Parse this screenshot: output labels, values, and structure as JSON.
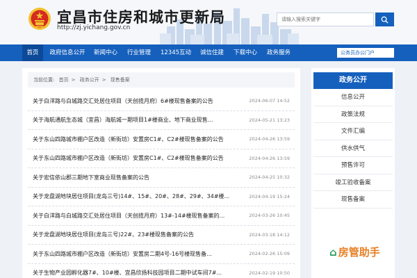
{
  "header": {
    "title": "宜昌市住房和城市更新局",
    "url": "http://zj.yichang.gov.cn",
    "search_placeholder": "请输入搜索关键字"
  },
  "nav": {
    "items": [
      {
        "label": "首页",
        "active": true
      },
      {
        "label": "政府信息公开"
      },
      {
        "label": "新闻中心"
      },
      {
        "label": "行业管理"
      },
      {
        "label": "12345互动"
      },
      {
        "label": "诚信住建"
      },
      {
        "label": "下载中心"
      },
      {
        "label": "政务服务"
      }
    ],
    "portal_label": "公务员办公门户"
  },
  "breadcrumb": {
    "prefix": "当前位置:",
    "items": [
      "首页",
      "政务公开",
      "现售备案"
    ]
  },
  "list": [
    {
      "title": "关于白洋路与白城路交汇处居住项目（天创揽月府）6#楼现售备案的公告",
      "date": "2024-06-07 14:52"
    },
    {
      "title": "关于海航通航生态城（宜昌）海航城一期项目1#楼商业、地下商业现售...",
      "date": "2024-05-21 13:23"
    },
    {
      "title": "关于东山四路城市棚户区改造（新街坊）安置房C1#、C2#楼现售备案的公告",
      "date": "2024-04-26 13:59"
    },
    {
      "title": "关于东山四路城市棚户区改造（新街坊）安置房C1#、C2#楼现售备案的公告",
      "date": "2024-04-26 13:59"
    },
    {
      "title": "关于宏信依山郡三期地下室商业现售备案的公告",
      "date": "2024-04-25 10:32"
    },
    {
      "title": "关于龙盘湖地块居住项目(龙岛三号)14#、15#、20#、28#、29#、34#楼...",
      "date": "2024-04-19 15:24"
    },
    {
      "title": "关于白洋路与白城路交汇处居住项目（天创揽月府）13#-14#楼现售备案的...",
      "date": "2024-03-26 10:45"
    },
    {
      "title": "关于龙盘湖地块居住项目(龙岛三号)22#、23#楼现售备案的公告",
      "date": "2024-03-18 14:12"
    },
    {
      "title": "关于东山四路城市棚户区改造（新街坊）安置房二期4号-16号楼现售备...",
      "date": "2024-02-26 15:09"
    },
    {
      "title": "关于生物产业园孵化器7#、10#楼、宜昌欣扬科技园项目二期中试车间7#...",
      "date": "2024-02-19 10:50"
    }
  ],
  "sidebar": {
    "title": "政务公开",
    "items": [
      "信息公开",
      "政策法规",
      "文件汇编",
      "供水供气",
      "预售许可",
      "竣工验收备案",
      "现售备案"
    ]
  },
  "watermark": {
    "text": "房管助手",
    "icon": "house-manager-icon"
  },
  "colors": {
    "primary": "#1560bd",
    "nav_active": "#0c4a99",
    "emblem_red": "#d42a20",
    "emblem_gold": "#f2c230"
  }
}
